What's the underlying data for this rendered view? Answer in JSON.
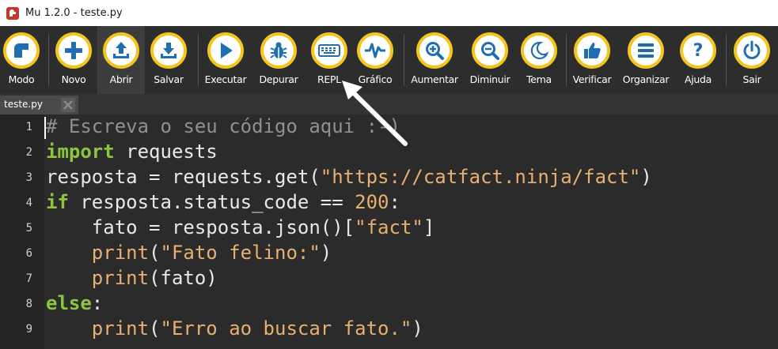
{
  "window": {
    "title": "Mu 1.2.0 - teste.py"
  },
  "toolbar": {
    "buttons": [
      {
        "id": "mode",
        "label": "Modo",
        "icon": "mode-icon"
      },
      {
        "id": "new",
        "label": "Novo",
        "icon": "plus-icon"
      },
      {
        "id": "load",
        "label": "Abrir",
        "icon": "upload-icon",
        "active": true
      },
      {
        "id": "save",
        "label": "Salvar",
        "icon": "download-icon"
      },
      {
        "id": "run",
        "label": "Executar",
        "icon": "play-icon"
      },
      {
        "id": "debug",
        "label": "Depurar",
        "icon": "bug-icon"
      },
      {
        "id": "repl",
        "label": "REPL",
        "icon": "keyboard-icon"
      },
      {
        "id": "plotter",
        "label": "Gráfico",
        "icon": "pulse-icon"
      },
      {
        "id": "zoom-in",
        "label": "Aumentar",
        "icon": "zoom-in-icon"
      },
      {
        "id": "zoom-out",
        "label": "Diminuir",
        "icon": "zoom-out-icon"
      },
      {
        "id": "theme",
        "label": "Tema",
        "icon": "moon-icon"
      },
      {
        "id": "check",
        "label": "Verificar",
        "icon": "thumbs-up-icon"
      },
      {
        "id": "tidy",
        "label": "Organizar",
        "icon": "lines-icon"
      },
      {
        "id": "help",
        "label": "Ajuda",
        "icon": "question-icon"
      },
      {
        "id": "quit",
        "label": "Sair",
        "icon": "power-icon"
      }
    ]
  },
  "tabs": [
    {
      "name": "teste.py",
      "close_icon": "close-icon"
    }
  ],
  "editor": {
    "line_numbers": [
      "1",
      "2",
      "3",
      "4",
      "5",
      "6",
      "7",
      "8",
      "9"
    ],
    "lines": [
      [
        {
          "t": "# Escreva o seu código aqui :-)",
          "c": "com"
        }
      ],
      [
        {
          "t": "import",
          "c": "kw"
        },
        {
          "t": " requests",
          "c": ""
        }
      ],
      [
        {
          "t": "resposta = requests.get(",
          "c": ""
        },
        {
          "t": "\"https://catfact.ninja/fact\"",
          "c": "str"
        },
        {
          "t": ")",
          "c": ""
        }
      ],
      [
        {
          "t": "if",
          "c": "kw"
        },
        {
          "t": " resposta.status_code == ",
          "c": ""
        },
        {
          "t": "200",
          "c": "num"
        },
        {
          "t": ":",
          "c": ""
        }
      ],
      [
        {
          "t": "    fato = resposta.json()[",
          "c": ""
        },
        {
          "t": "\"fact\"",
          "c": "str"
        },
        {
          "t": "]",
          "c": ""
        }
      ],
      [
        {
          "t": "    ",
          "c": ""
        },
        {
          "t": "print",
          "c": "bi"
        },
        {
          "t": "(",
          "c": ""
        },
        {
          "t": "\"Fato felino:\"",
          "c": "str"
        },
        {
          "t": ")",
          "c": ""
        }
      ],
      [
        {
          "t": "    ",
          "c": ""
        },
        {
          "t": "print",
          "c": "bi"
        },
        {
          "t": "(fato)",
          "c": ""
        }
      ],
      [
        {
          "t": "else",
          "c": "kw"
        },
        {
          "t": ":",
          "c": ""
        }
      ],
      [
        {
          "t": "    ",
          "c": ""
        },
        {
          "t": "print",
          "c": "bi"
        },
        {
          "t": "(",
          "c": ""
        },
        {
          "t": "\"Erro ao buscar fato.\"",
          "c": "str"
        },
        {
          "t": ")",
          "c": ""
        }
      ]
    ]
  },
  "colors": {
    "accent": "#f2c61f",
    "keyword": "#8cc63f",
    "string": "#e8b070",
    "comment": "#909090"
  }
}
